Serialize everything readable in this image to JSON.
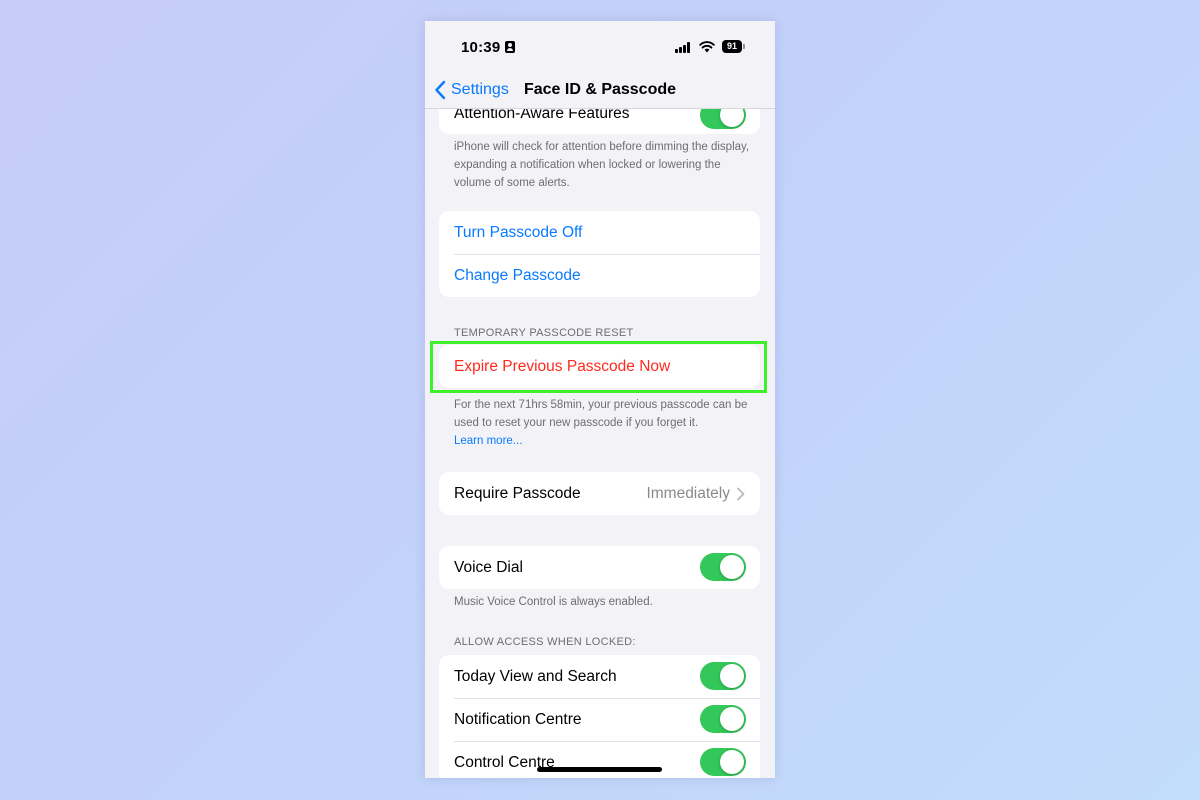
{
  "status": {
    "time": "10:39",
    "battery": "91"
  },
  "nav": {
    "back_label": "Settings",
    "title": "Face ID & Passcode"
  },
  "attention": {
    "label": "Attention-Aware Features",
    "footer": "iPhone will check for attention before dimming the display, expanding a notification when locked or lowering the volume of some alerts."
  },
  "passcode": {
    "turn_off": "Turn Passcode Off",
    "change": "Change Passcode"
  },
  "temp_reset": {
    "header": "TEMPORARY PASSCODE RESET",
    "expire": "Expire Previous Passcode Now",
    "footer": "For the next 71hrs 58min, your previous passcode can be used to reset your new passcode if you forget it.",
    "learn_more": "Learn more..."
  },
  "require": {
    "label": "Require Passcode",
    "value": "Immediately"
  },
  "voice": {
    "label": "Voice Dial",
    "footer": "Music Voice Control is always enabled."
  },
  "locked": {
    "header": "ALLOW ACCESS WHEN LOCKED:",
    "items": [
      {
        "label": "Today View and Search"
      },
      {
        "label": "Notification Centre"
      },
      {
        "label": "Control Centre"
      }
    ]
  },
  "colors": {
    "accent": "#0a7aff",
    "destructive": "#ff2a1f",
    "toggle_on": "#34c759",
    "highlight": "#3ef02a"
  }
}
